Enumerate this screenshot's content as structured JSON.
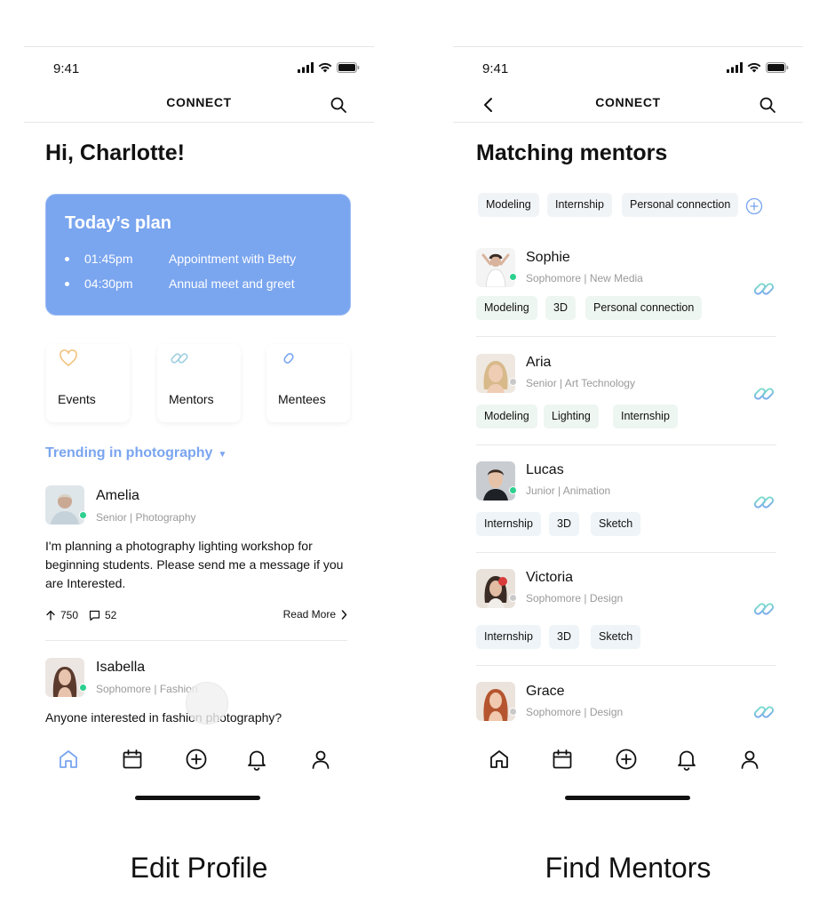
{
  "left_screen": {
    "caption": "Edit Profile",
    "status": {
      "time": "9:41"
    },
    "nav": {
      "title": "CONNECT"
    },
    "greeting": "Hi, Charlotte!",
    "plan": {
      "title": "Today’s plan",
      "items": [
        {
          "time": "01:45pm",
          "text": "Appointment with Betty"
        },
        {
          "time": "04:30pm",
          "text": "Annual meet and greet"
        }
      ]
    },
    "quick_links": [
      {
        "label": "Events",
        "icon": "heart-icon",
        "color": "#f2c27c"
      },
      {
        "label": "Mentors",
        "icon": "link-icon",
        "color": "#9ecfe0"
      },
      {
        "label": "Mentees",
        "icon": "paperclip-icon",
        "color": "#7aa5ef"
      }
    ],
    "trending": {
      "label": "Trending in photography",
      "caret": "▼"
    },
    "posts": [
      {
        "name": "Amelia",
        "sub": "Senior | Photography",
        "status": "online",
        "body": "I'm planning a photography lighting workshop for beginning students. Please send me a message if you are Interested.",
        "upvotes": "750",
        "comments": "52",
        "read_more": "Read More"
      },
      {
        "name": "Isabella",
        "sub": "Sophomore | Fashion",
        "status": "online",
        "body": "Anyone interested in fashion photography?"
      }
    ],
    "tabs": [
      "home-icon",
      "calendar-icon",
      "add-circle-icon",
      "bell-icon",
      "profile-icon"
    ],
    "active_tab": "home-icon"
  },
  "right_screen": {
    "caption": "Find Mentors",
    "status": {
      "time": "9:41"
    },
    "nav": {
      "title": "CONNECT"
    },
    "title": "Matching mentors",
    "filters": [
      "Modeling",
      "Internship",
      "Personal connection"
    ],
    "mentors": [
      {
        "name": "Sophie",
        "sub": "Sophomore | New Media",
        "status": "online",
        "tags": [
          "Modeling",
          "3D",
          "Personal connection"
        ]
      },
      {
        "name": "Aria",
        "sub": "Senior | Art Technology",
        "status": "offline",
        "tags": [
          "Modeling",
          "Lighting",
          "Internship"
        ]
      },
      {
        "name": "Lucas",
        "sub": "Junior | Animation",
        "status": "online",
        "tags": [
          "Internship",
          "3D",
          "Sketch"
        ]
      },
      {
        "name": "Victoria",
        "sub": "Sophomore | Design",
        "status": "offline",
        "tags": [
          "Internship",
          "3D",
          "Sketch"
        ]
      },
      {
        "name": "Grace",
        "sub": "Sophomore | Design",
        "status": "offline",
        "tags": []
      }
    ],
    "tabs": [
      "home-icon",
      "calendar-icon",
      "add-circle-icon",
      "bell-icon",
      "profile-icon"
    ]
  },
  "colors": {
    "accent": "#7aa5ef",
    "online": "#2dcf8f",
    "offline": "#c9c9c9",
    "link_gradient_start": "#7aa5ef",
    "link_gradient_end": "#7fe3c8"
  }
}
